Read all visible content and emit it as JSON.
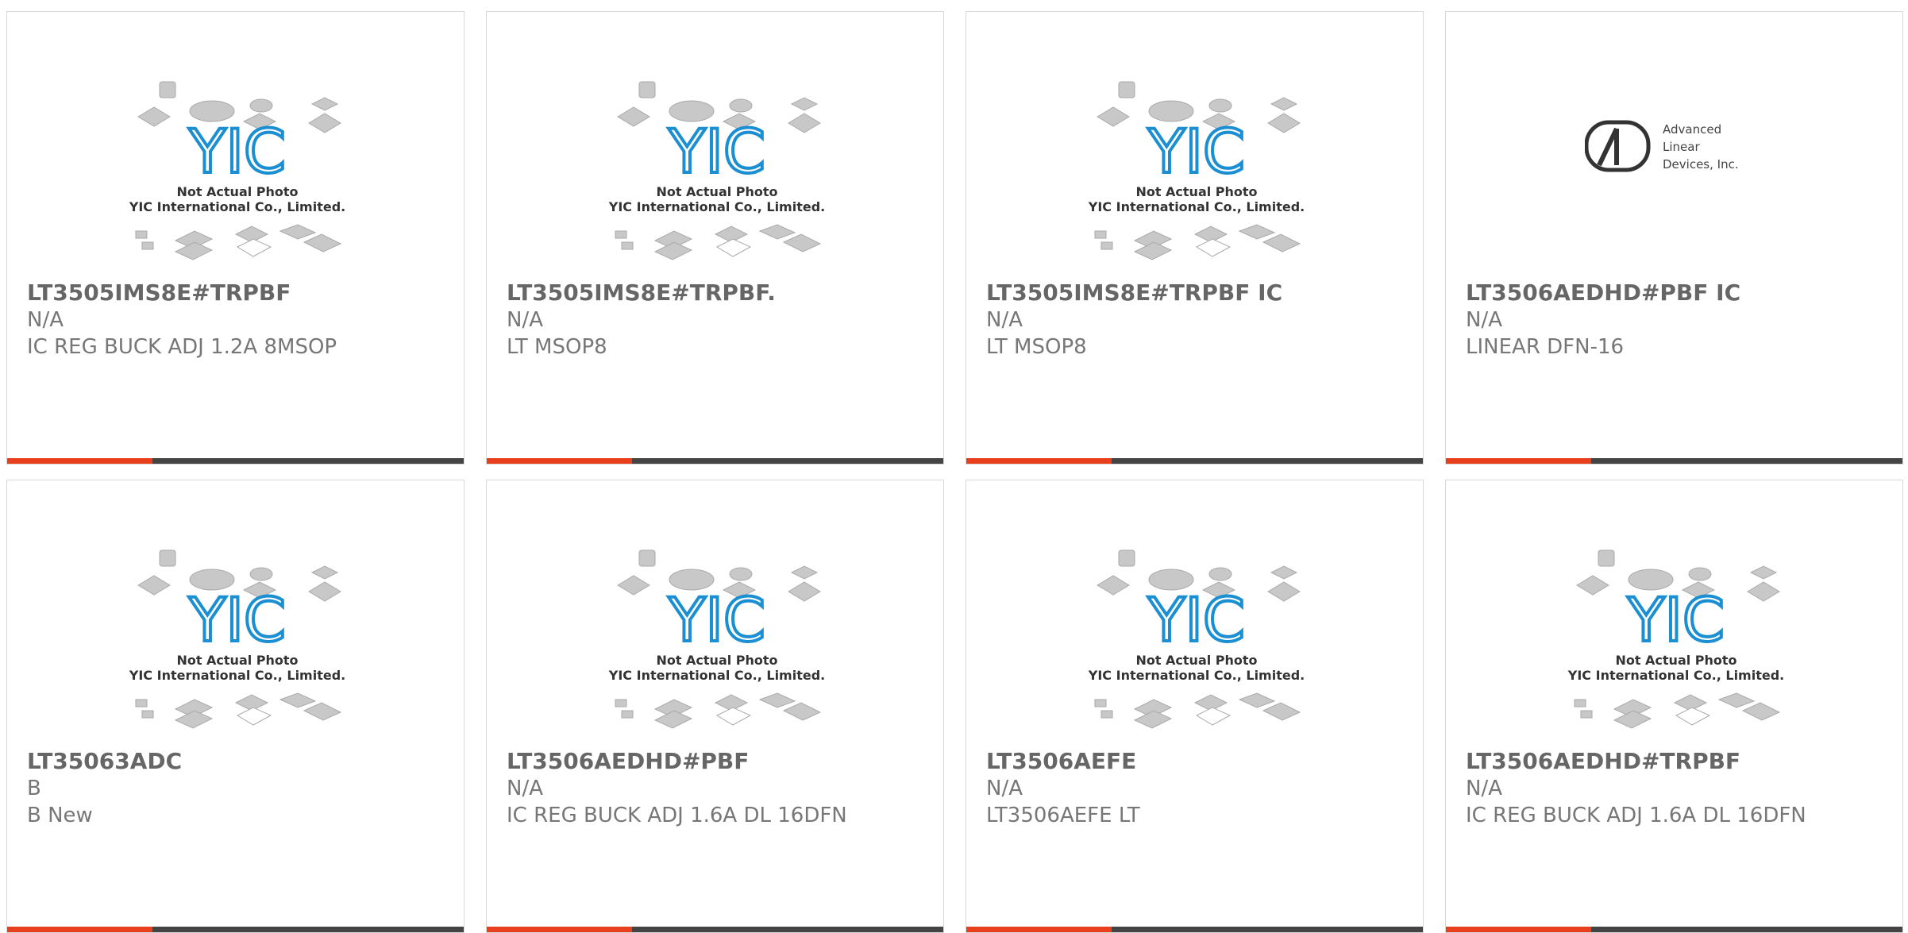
{
  "colors": {
    "accent": "#e8401c",
    "bar": "#444444",
    "logo_blue": "#1b8fd2",
    "text": "#666666"
  },
  "placeholder": {
    "line1": "Not Actual Photo",
    "line2": "YIC International Co., Limited.",
    "logo_text": "YIC"
  },
  "adl_logo": {
    "line1": "Advanced",
    "line2": "Linear",
    "line3": "Devices, Inc."
  },
  "products": [
    {
      "title": "LT3505IMS8E#TRPBF",
      "sub": "N/A",
      "desc": "IC REG BUCK ADJ 1.2A 8MSOP",
      "image": "yic-placeholder"
    },
    {
      "title": "LT3505IMS8E#TRPBF.",
      "sub": "N/A",
      "desc": "LT MSOP8",
      "image": "yic-placeholder"
    },
    {
      "title": "LT3505IMS8E#TRPBF IC",
      "sub": "N/A",
      "desc": "LT MSOP8",
      "image": "yic-placeholder"
    },
    {
      "title": "LT3506AEDHD#PBF IC",
      "sub": "N/A",
      "desc": "LINEAR DFN-16",
      "image": "adl-logo"
    },
    {
      "title": "LT35063ADC",
      "sub": "B",
      "desc": "B New",
      "image": "yic-placeholder"
    },
    {
      "title": "LT3506AEDHD#PBF",
      "sub": "N/A",
      "desc": "IC REG BUCK ADJ 1.6A DL 16DFN",
      "image": "yic-placeholder"
    },
    {
      "title": "LT3506AEFE",
      "sub": "N/A",
      "desc": "LT3506AEFE LT",
      "image": "yic-placeholder"
    },
    {
      "title": "LT3506AEDHD#TRPBF",
      "sub": "N/A",
      "desc": "IC REG BUCK ADJ 1.6A DL 16DFN",
      "image": "yic-placeholder"
    }
  ]
}
